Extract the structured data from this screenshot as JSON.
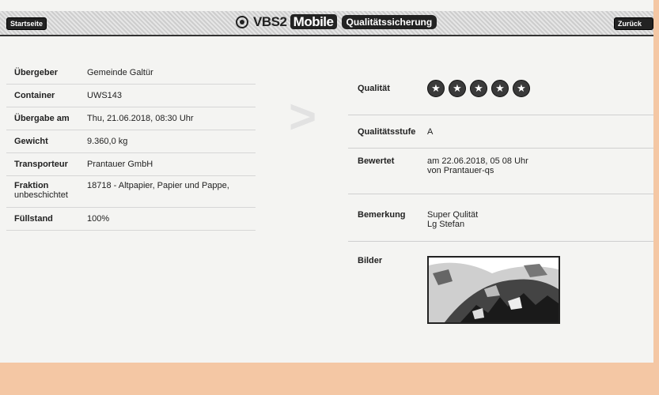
{
  "header": {
    "home_label": "Startseite",
    "app_title_prefix": "VBS2",
    "app_title_suffix": "Mobile",
    "module_label": "Qualitätssicherung",
    "right_button_label": "Zurück"
  },
  "details": [
    {
      "label": "Übergeber",
      "value": "Gemeinde Galtür"
    },
    {
      "label": "Container",
      "value": "UWS143"
    },
    {
      "label": "Übergabe am",
      "value": "Thu, 21.06.2018, 08:30 Uhr"
    },
    {
      "label": "Gewicht",
      "value": "9.360,0 kg"
    },
    {
      "label": "Transporteur",
      "value": "Prantauer GmbH"
    },
    {
      "label": "Fraktion",
      "value": "18718 - Altpapier, Papier und Pappe,",
      "label_sub": "unbeschichtet"
    },
    {
      "label": "Füllstand",
      "value": "100%"
    }
  ],
  "rating": {
    "quality_label": "Qualität",
    "stars": 5,
    "star_glyph": "★",
    "level_label": "Qualitätsstufe",
    "level_value": "A",
    "rated_label": "Bewertet",
    "rated_line1": "am 22.06.2018, 05 08 Uhr",
    "rated_line2": "von Prantauer-qs",
    "remark_label": "Bemerkung",
    "remark_line1": "Super Qulität",
    "remark_line2": "Lg Stefan",
    "images_label": "Bilder"
  }
}
